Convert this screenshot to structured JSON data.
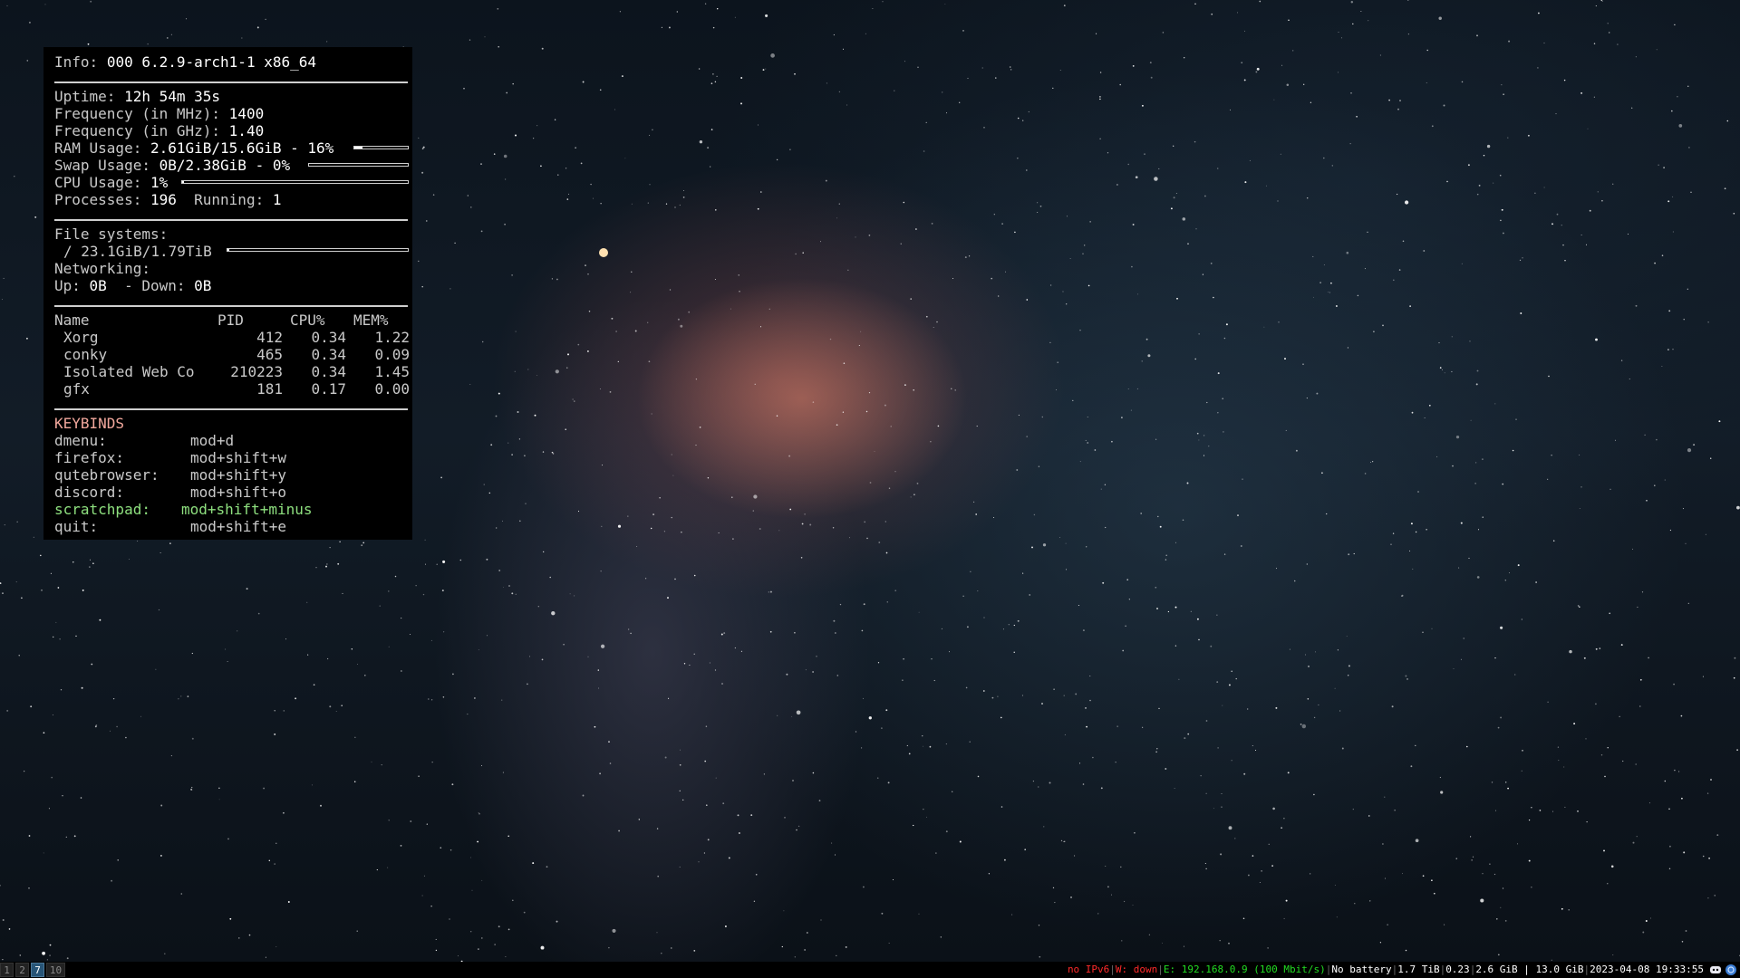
{
  "conky": {
    "info": {
      "label": "Info:",
      "value": "000 6.2.9-arch1-1 x86_64"
    },
    "uptime": {
      "label": "Uptime:",
      "value": "12h 54m 35s"
    },
    "freq_mhz": {
      "label": "Frequency (in MHz):",
      "value": "1400"
    },
    "freq_ghz": {
      "label": "Frequency (in GHz):",
      "value": "1.40"
    },
    "ram": {
      "label": "RAM Usage:",
      "value": "2.61GiB/15.6GiB - 16%",
      "percent": 16
    },
    "swap": {
      "label": "Swap Usage:",
      "value": "0B/2.38GiB - 0%",
      "percent": 0
    },
    "cpu": {
      "label": "CPU Usage:",
      "value": "1%",
      "percent": 1
    },
    "processes": {
      "label": "Processes:",
      "value": "196",
      "running_label": "Running:",
      "running_value": "1"
    },
    "filesystems": {
      "label": "File systems:",
      "root": "/ 23.1GiB/1.79TiB",
      "percent": 1
    },
    "networking": {
      "label": "Networking:",
      "up_label": "Up:",
      "up_value": "0B",
      "down_label": "- Down:",
      "down_value": "0B"
    },
    "process_table": {
      "headers": [
        "Name",
        "PID",
        "CPU%",
        "MEM%"
      ],
      "rows": [
        {
          "name": "Xorg",
          "pid": "412",
          "cpu": "0.34",
          "mem": "1.22"
        },
        {
          "name": "conky",
          "pid": "465",
          "cpu": "0.34",
          "mem": "0.09"
        },
        {
          "name": "Isolated Web Co",
          "pid": "210223",
          "cpu": "0.34",
          "mem": "1.45"
        },
        {
          "name": "gfx",
          "pid": "181",
          "cpu": "0.17",
          "mem": "0.00"
        }
      ]
    },
    "keybinds": {
      "title": "KEYBINDS",
      "items": [
        {
          "key": "dmenu:",
          "binding": "mod+d"
        },
        {
          "key": "firefox:",
          "binding": "mod+shift+w"
        },
        {
          "key": "qutebrowser:",
          "binding": "mod+shift+y"
        },
        {
          "key": "discord:",
          "binding": "mod+shift+o"
        },
        {
          "key": "scratchpad:",
          "binding": "mod+shift+minus",
          "highlight": true
        },
        {
          "key": "quit:",
          "binding": "mod+shift+e"
        }
      ]
    }
  },
  "bar": {
    "workspaces": [
      {
        "label": "1",
        "active": false
      },
      {
        "label": "2",
        "active": false
      },
      {
        "label": "7",
        "active": true
      },
      {
        "label": "10",
        "active": false
      }
    ],
    "status": [
      {
        "text": "no IPv6",
        "color": "#ff2a2a"
      },
      {
        "text": "W: down",
        "color": "#ff2a2a"
      },
      {
        "text": "E: 192.168.0.9 (100 Mbit/s)",
        "color": "#22dd22"
      },
      {
        "text": "No battery",
        "color": "#ffffff"
      },
      {
        "text": "1.7 TiB",
        "color": "#ffffff"
      },
      {
        "text": "0.23",
        "color": "#ffffff"
      },
      {
        "text": "2.6 GiB | 13.0 GiB",
        "color": "#ffffff"
      },
      {
        "text": "2023-04-08 19:33:55",
        "color": "#ffffff"
      }
    ],
    "tray": [
      "discord-icon",
      "network-icon"
    ]
  },
  "colors": {
    "conky_bg": "#000000",
    "conky_text": "#c9c9c9",
    "keybinds_title": "#f2a89d",
    "highlight_green": "#8ee07f",
    "workspace_active": "#285577"
  }
}
